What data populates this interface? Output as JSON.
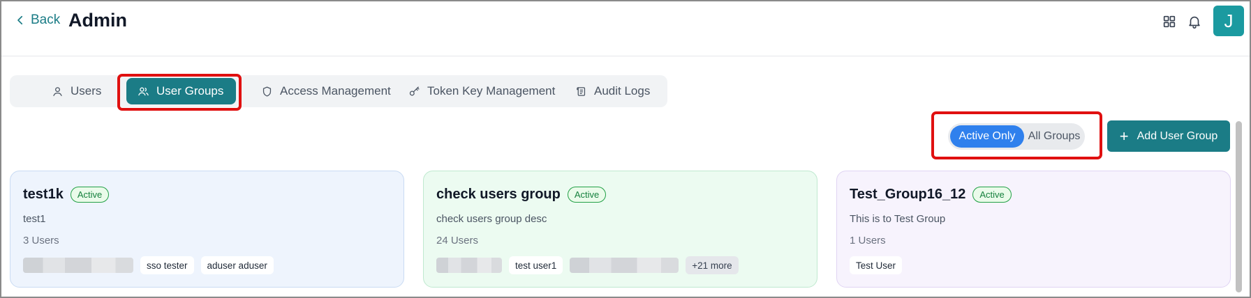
{
  "header": {
    "back_label": "Back",
    "title": "Admin",
    "avatar_initial": "J"
  },
  "tabs": [
    {
      "label": "Users",
      "icon": "user-icon"
    },
    {
      "label": "User Groups",
      "icon": "users-icon",
      "active": true
    },
    {
      "label": "Access Management",
      "icon": "shield-icon"
    },
    {
      "label": "Token Key Management",
      "icon": "key-icon"
    },
    {
      "label": "Audit Logs",
      "icon": "scroll-icon"
    }
  ],
  "filter": {
    "active_only": "Active Only",
    "all_groups": "All Groups",
    "selected": "Active Only"
  },
  "add_button_label": "Add User Group",
  "groups": [
    {
      "name": "test1k",
      "status": "Active",
      "description": "test1",
      "user_count": "3 Users",
      "members": [
        "sso tester",
        "aduser aduser"
      ],
      "more": ""
    },
    {
      "name": "check users group",
      "status": "Active",
      "description": "check users group desc",
      "user_count": "24 Users",
      "members": [
        "test user1"
      ],
      "more": "+21 more"
    },
    {
      "name": "Test_Group16_12",
      "status": "Active",
      "description": "This is to Test Group",
      "user_count": "1 Users",
      "members": [
        "Test User"
      ],
      "more": ""
    }
  ],
  "colors": {
    "primary": "#1b7c86",
    "toggle_active": "#2f80ed",
    "highlight": "#e01010",
    "badge_green": "#22a046",
    "card1_bg": "#eef4fd",
    "card2_bg": "#ecfbf1",
    "card3_bg": "#f7f3fd"
  }
}
